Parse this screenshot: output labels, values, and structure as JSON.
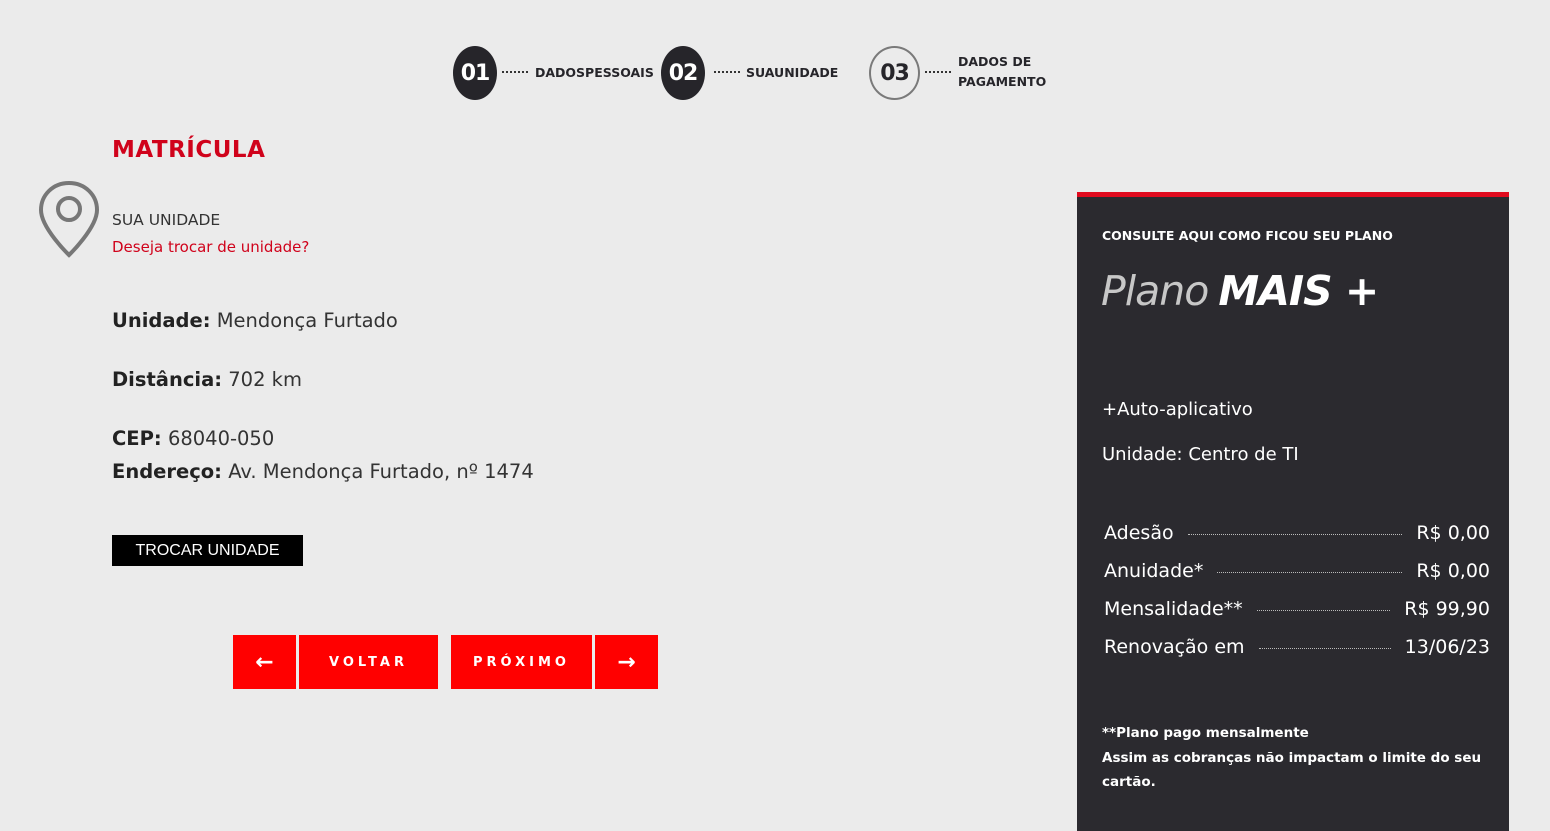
{
  "stepper": {
    "steps": [
      {
        "number": "01",
        "label": "DADOSPESSOAIS",
        "state": "done"
      },
      {
        "number": "02",
        "label": "SUAUNIDADE",
        "state": "done"
      },
      {
        "number": "03",
        "label_line1": "DADOS DE",
        "label_line2": "PAGAMENTO",
        "state": "todo"
      }
    ]
  },
  "page_title": "MATRÍCULA",
  "unit_section": {
    "caption": "SUA UNIDADE",
    "change_link": "Deseja trocar de unidade?",
    "unit_label": "Unidade:",
    "unit_value": "Mendonça Furtado",
    "distance_label": "Distância:",
    "distance_value": "702 km",
    "cep_label": "CEP:",
    "cep_value": "68040-050",
    "address_label": "Endereço:",
    "address_value": "Av. Mendonça Furtado, nº 1474",
    "swap_button": "TROCAR UNIDADE"
  },
  "navigation": {
    "back_arrow": "←",
    "back_label": "VOLTAR",
    "next_label": "PRÓXIMO",
    "next_arrow": "→"
  },
  "plan_card": {
    "caption": "CONSULTE AQUI COMO FICOU SEU PLANO",
    "name_light": "Plano",
    "name_bold": "MAIS +",
    "feature": "+Auto-aplicativo",
    "unit": "Unidade: Centro de TI",
    "prices": [
      {
        "label": "Adesão",
        "value": "R$ 0,00"
      },
      {
        "label": "Anuidade*",
        "value": "R$ 0,00"
      },
      {
        "label": "Mensalidade**",
        "value": "R$ 99,90"
      },
      {
        "label": "Renovação em",
        "value": "13/06/23"
      }
    ],
    "note_line1": "**Plano pago mensalmente",
    "note_line2": "Assim as cobranças não impactam o limite do seu cartão."
  },
  "colors": {
    "accent_red": "#d0021b",
    "button_red": "#ff0000",
    "card_bg": "#2b2a2f",
    "page_bg": "#ebebeb"
  }
}
